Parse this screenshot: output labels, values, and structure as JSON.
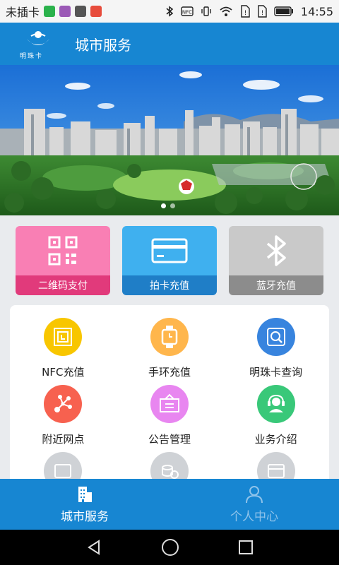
{
  "status_bar": {
    "carrier": "未插卡",
    "time": "14:55",
    "icons": [
      "wechat-icon",
      "gallery-icon",
      "camera-icon",
      "app-icon",
      "bluetooth-icon",
      "nfc-icon",
      "vibrate-icon",
      "wifi-icon",
      "sim-icon",
      "sim-icon",
      "battery-icon"
    ]
  },
  "header": {
    "logo_text": "明珠卡",
    "title": "城市服务"
  },
  "banner": {
    "slide_count": 2,
    "active_index": 0
  },
  "actions": [
    {
      "label": "二维码支付",
      "icon": "qrcode-icon",
      "top_color": "#f97fb4",
      "bottom_color": "#e13a7b"
    },
    {
      "label": "拍卡充值",
      "icon": "card-icon",
      "top_color": "#3fb0ef",
      "bottom_color": "#1f7ec7"
    },
    {
      "label": "蓝牙充值",
      "icon": "bluetooth-icon",
      "top_color": "#c9c9c9",
      "bottom_color": "#8c8c8c"
    }
  ],
  "services": [
    {
      "label": "NFC充值",
      "icon": "nfc-icon",
      "color": "#f8c600"
    },
    {
      "label": "手环充值",
      "icon": "smartwatch-icon",
      "color": "#ffb64c"
    },
    {
      "label": "明珠卡查询",
      "icon": "search-card-icon",
      "color": "#3884de"
    },
    {
      "label": "附近网点",
      "icon": "network-icon",
      "color": "#f7614f"
    },
    {
      "label": "公告管理",
      "icon": "notice-board-icon",
      "color": "#e886f0"
    },
    {
      "label": "业务介绍",
      "icon": "headset-icon",
      "color": "#39c879"
    },
    {
      "label": "",
      "icon": "diy-icon",
      "color": "#cfd2d6"
    },
    {
      "label": "",
      "icon": "coins-icon",
      "color": "#cfd2d6"
    },
    {
      "label": "",
      "icon": "welfare-icon",
      "color": "#cfd2d6"
    }
  ],
  "bottom_nav": [
    {
      "label": "城市服务",
      "icon": "building-icon",
      "active": true
    },
    {
      "label": "个人中心",
      "icon": "person-icon",
      "active": false
    }
  ],
  "colors": {
    "brand": "#1786d2",
    "page_bg": "#e9ebee"
  }
}
